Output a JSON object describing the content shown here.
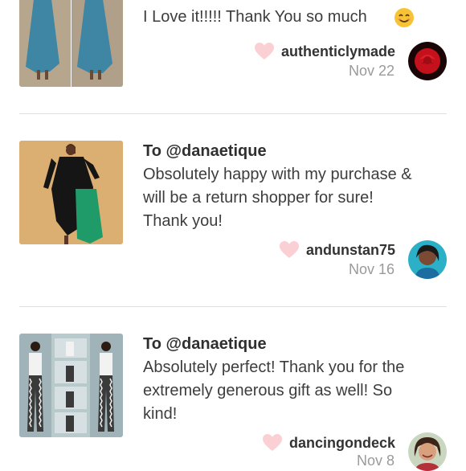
{
  "reviews": [
    {
      "to": "",
      "message_lines": [
        "I Love it!!!!! Thank You so much"
      ],
      "emoji": "smiling-face-emoji",
      "username": "authenticlymade",
      "date": "Nov 22",
      "avatar": "red-rose-avatar"
    },
    {
      "to": "To @danaetique",
      "message_lines": [
        "Obsolutely happy with my purchase &",
        "will be a return shopper for sure!",
        "Thank you!"
      ],
      "username": "andunstan75",
      "date": "Nov 16",
      "avatar": "woman-portrait-avatar"
    },
    {
      "to": "To @danaetique",
      "message_lines": [
        "Absolutely perfect! Thank you for the",
        "extremely generous gift as well! So",
        "kind!"
      ],
      "username": "dancingondeck",
      "date": "Nov 8",
      "avatar": "woman-smiling-avatar"
    }
  ],
  "colors": {
    "heart": "#fbd0d4",
    "divider": "#e2e2e2",
    "date": "#9a9a9a"
  }
}
